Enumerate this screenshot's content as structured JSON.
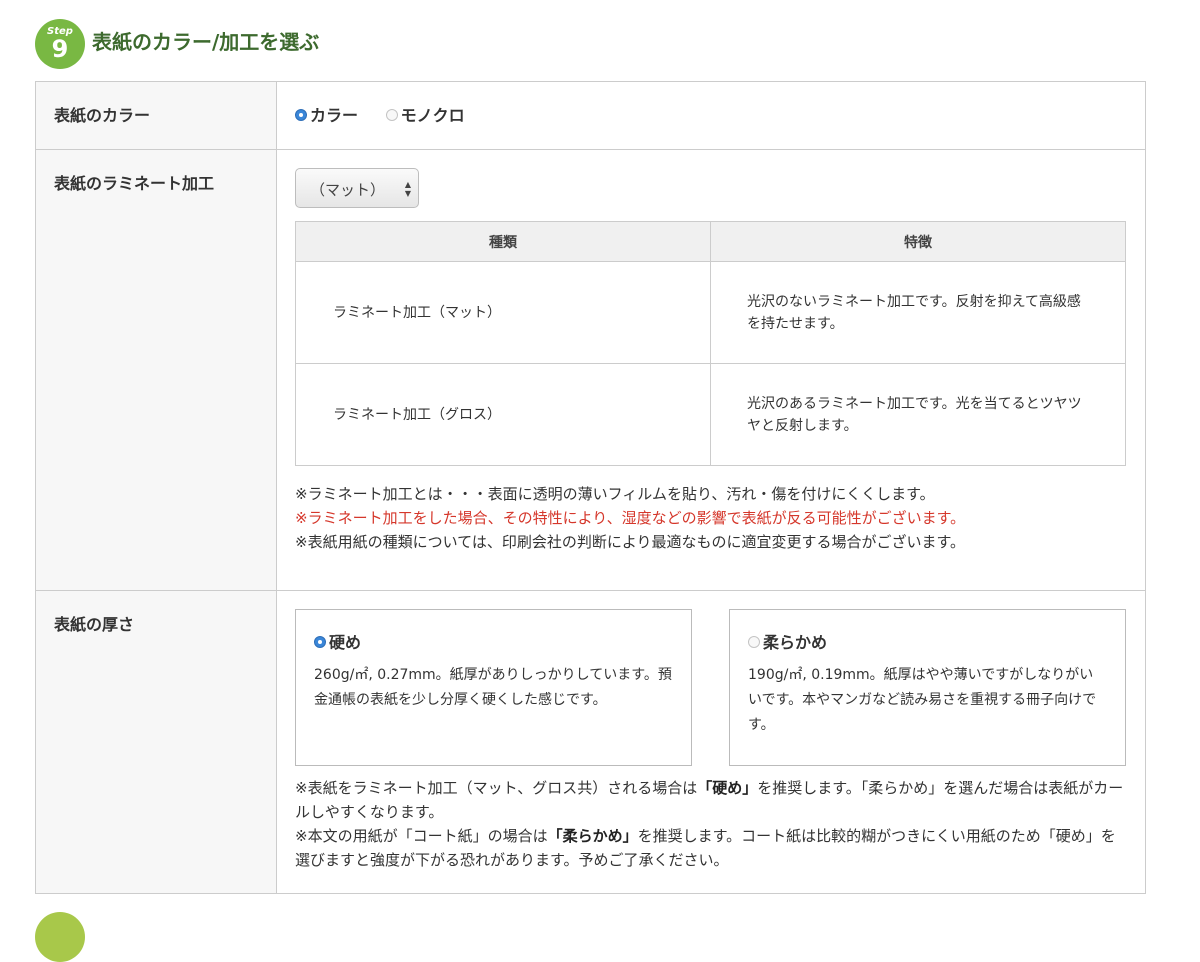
{
  "header": {
    "step_word": "Step",
    "step_number": "9",
    "title": "表紙のカラー/加工を選ぶ",
    "accent_color": "#79b843",
    "title_color": "#3d6a2e"
  },
  "color_row": {
    "label": "表紙のカラー",
    "options": [
      {
        "label": "カラー",
        "selected": true
      },
      {
        "label": "モノクロ",
        "selected": false
      }
    ]
  },
  "laminate_row": {
    "label": "表紙のラミネート加工",
    "select": {
      "value": "（マット）"
    },
    "table": {
      "headers": [
        "種類",
        "特徴"
      ],
      "rows": [
        {
          "kind": "ラミネート加工（マット）",
          "feature": "光沢のないラミネート加工です。反射を抑えて高級感を持たせます。"
        },
        {
          "kind": "ラミネート加工（グロス）",
          "feature": "光沢のあるラミネート加工です。光を当てるとツヤツヤと反射します。"
        }
      ]
    },
    "notes": [
      "※ラミネート加工とは・・・表面に透明の薄いフィルムを貼り、汚れ・傷を付けにくくします。",
      "※ラミネート加工をした場合、その特性により、湿度などの影響で表紙が反る可能性がございます。",
      "※表紙用紙の種類については、印刷会社の判断により最適なものに適宜変更する場合がございます。"
    ],
    "warning_color": "#d5372b"
  },
  "thickness_row": {
    "label": "表紙の厚さ",
    "options": [
      {
        "label": "硬め",
        "selected": true,
        "description": "260g/㎡, 0.27mm。紙厚がありしっかりしています。預金通帳の表紙を少し分厚く硬くした感じです。"
      },
      {
        "label": "柔らかめ",
        "selected": false,
        "description": "190g/㎡, 0.19mm。紙厚はやや薄いですがしなりがいいです。本やマンガなど読み易さを重視する冊子向けです。"
      }
    ],
    "note1": {
      "pre": "※表紙をラミネート加工（マット、グロス共）される場合は",
      "bold": "「硬め」",
      "post": "を推奨します。「柔らかめ」を選んだ場合は表紙がカールしやすくなります。"
    },
    "note2": {
      "pre": "※本文の用紙が「コート紙」の場合は",
      "bold": "「柔らかめ」",
      "post": "を推奨します。コート紙は比較的糊がつきにくい用紙のため「硬め」を選びますと強度が下がる恐れがあります。予めご了承ください。"
    }
  }
}
